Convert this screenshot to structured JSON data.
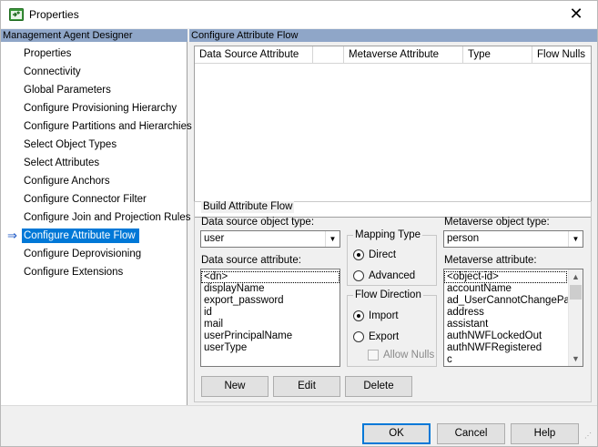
{
  "window": {
    "title": "Properties",
    "close_glyph": "✕",
    "app_icon": "properties-app-icon"
  },
  "left_pane": {
    "header": "Management Agent Designer",
    "current_marker": "⇒",
    "items": [
      {
        "label": "Properties"
      },
      {
        "label": "Connectivity"
      },
      {
        "label": "Global Parameters"
      },
      {
        "label": "Configure Provisioning Hierarchy"
      },
      {
        "label": "Configure Partitions and Hierarchies"
      },
      {
        "label": "Select Object Types"
      },
      {
        "label": "Select Attributes"
      },
      {
        "label": "Configure Anchors"
      },
      {
        "label": "Configure Connector Filter"
      },
      {
        "label": "Configure Join and Projection Rules"
      },
      {
        "label": "Configure Attribute Flow",
        "selected": true
      },
      {
        "label": "Configure Deprovisioning"
      },
      {
        "label": "Configure Extensions"
      }
    ]
  },
  "right_pane": {
    "header": "Configure Attribute Flow",
    "grid": {
      "columns": [
        "Data Source Attribute",
        "",
        "Metaverse Attribute",
        "Type",
        "Flow Nulls"
      ],
      "rows": []
    },
    "build": {
      "group_label": "Build Attribute Flow",
      "ds_object_type_label": "Data source object type:",
      "ds_object_type_value": "user",
      "ds_attribute_label": "Data source attribute:",
      "ds_attributes": [
        "<dn>",
        "displayName",
        "export_password",
        "id",
        "mail",
        "userPrincipalName",
        "userType"
      ],
      "mapping_type": {
        "label": "Mapping Type",
        "options": [
          {
            "label": "Direct",
            "checked": true
          },
          {
            "label": "Advanced",
            "checked": false
          }
        ]
      },
      "flow_direction": {
        "label": "Flow Direction",
        "options": [
          {
            "label": "Import",
            "checked": true
          },
          {
            "label": "Export",
            "checked": false
          }
        ],
        "allow_nulls_label": "Allow Nulls",
        "allow_nulls_checked": false
      },
      "mv_object_type_label": "Metaverse object type:",
      "mv_object_type_value": "person",
      "mv_attribute_label": "Metaverse attribute:",
      "mv_attributes": [
        "<object-id>",
        "accountName",
        "ad_UserCannotChangePass",
        "address",
        "assistant",
        "authNWFLockedOut",
        "authNWFRegistered",
        "c"
      ],
      "buttons": {
        "new": "New",
        "edit": "Edit",
        "delete": "Delete"
      }
    }
  },
  "footer": {
    "ok": "OK",
    "cancel": "Cancel",
    "help": "Help"
  },
  "colors": {
    "accent": "#0078d7",
    "pane_header": "#8fa6c8",
    "marker": "#1a56c4"
  }
}
